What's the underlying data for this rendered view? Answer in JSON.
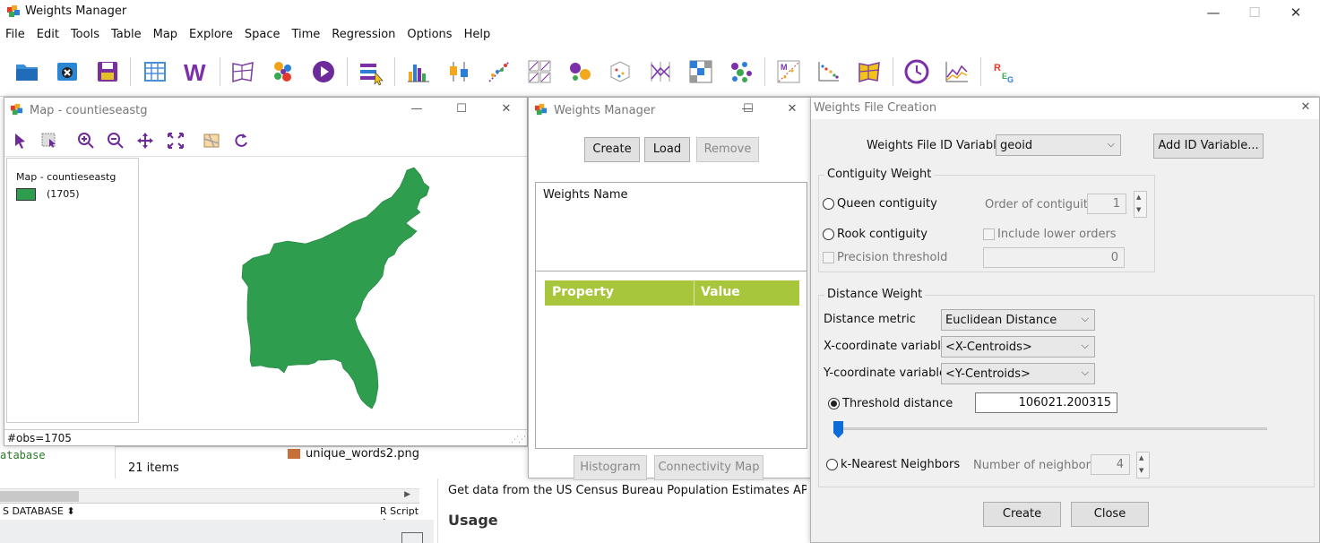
{
  "app": {
    "title": "Weights Manager"
  },
  "window_controls": {
    "minimize": "—",
    "maximize": "☐",
    "close": "✕"
  },
  "menu": [
    "File",
    "Edit",
    "Tools",
    "Table",
    "Map",
    "Explore",
    "Space",
    "Time",
    "Regression",
    "Options",
    "Help"
  ],
  "toolbar_icons": [
    "open-project-icon",
    "close-project-icon",
    "save-icon",
    "table-icon",
    "weights-manager-icon",
    "map-icon",
    "cartogram-icon",
    "animation-icon",
    "category-editor-icon",
    "histogram-icon",
    "box-plot-icon",
    "scatter-plot-icon",
    "scatter-matrix-icon",
    "bubble-chart-icon",
    "3d-scatter-icon",
    "parallel-coordinate-icon",
    "conditional-plot-icon",
    "cluster-icon",
    "moran-scatter-icon",
    "lisa-icon",
    "spatial-regression-map-icon",
    "time-editor-icon",
    "average-chart-icon",
    "regression-icon"
  ],
  "background": {
    "db_text": "atabase",
    "statusbar_left": "S DATABASE ⬍",
    "statusbar_right": "R Script ⬍",
    "file_name": "unique_words2.png",
    "items_count": "21 items",
    "doc_line": "Get data from the US Census Bureau Population Estimates APIs",
    "doc_heading": "Usage"
  },
  "map_window": {
    "title": "Map - countieseastg",
    "legend_title": "Map - countieseastg",
    "legend_count": "(1705)",
    "status": "#obs=1705",
    "fill_color": "#2e9e4e",
    "tools": [
      "select-icon",
      "select-extent-icon",
      "zoom-in-icon",
      "zoom-out-icon",
      "pan-icon",
      "fit-extent-icon",
      "basemap-icon",
      "refresh-icon"
    ]
  },
  "weights_manager": {
    "title": "Weights Manager",
    "create_label": "Create",
    "load_label": "Load",
    "remove_label": "Remove",
    "names_header": "Weights Name",
    "property_header": "Property",
    "value_header": "Value",
    "histogram_label": "Histogram",
    "connectivity_label": "Connectivity Map",
    "header_color": "#a7c63b"
  },
  "weights_creation": {
    "title": "Weights File Creation",
    "id_label": "Weights File ID Variable",
    "id_value": "geoid",
    "add_id_label": "Add ID Variable...",
    "contiguity_group": "Contiguity Weight",
    "queen_label": "Queen contiguity",
    "rook_label": "Rook contiguity",
    "order_label": "Order of contiguity",
    "order_value": "1",
    "include_lower_label": "Include lower orders",
    "precision_label": "Precision threshold",
    "precision_value": "0",
    "distance_group": "Distance Weight",
    "metric_label": "Distance metric",
    "metric_value": "Euclidean Distance",
    "x_label": "X-coordinate variable",
    "x_value": "<X-Centroids>",
    "y_label": "Y-coordinate variable",
    "y_value": "<Y-Centroids>",
    "threshold_label": "Threshold distance",
    "threshold_value": "106021.200315",
    "knn_label": "k-Nearest Neighbors",
    "neighbors_label": "Number of neighbors",
    "neighbors_value": "4",
    "create_label": "Create",
    "close_label": "Close",
    "slider_fraction": 0.0
  }
}
